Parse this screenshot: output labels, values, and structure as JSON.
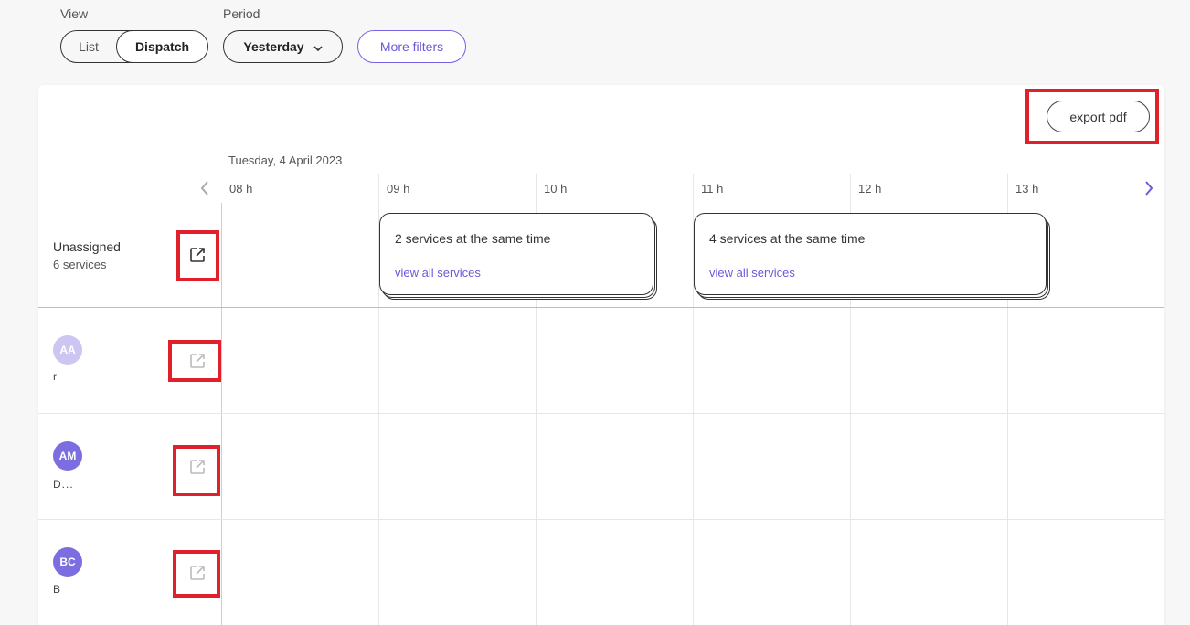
{
  "filters": {
    "view_label": "View",
    "view_options": [
      "List",
      "Dispatch"
    ],
    "view_selected": "Dispatch",
    "period_label": "Period",
    "period_value": "Yesterday",
    "more_filters": "More filters"
  },
  "toolbar": {
    "export_label": "export pdf"
  },
  "timeline": {
    "date": "Tuesday, 4 April 2023",
    "hours": [
      "08 h",
      "09 h",
      "10 h",
      "11 h",
      "12 h",
      "13 h"
    ]
  },
  "unassigned": {
    "title": "Unassigned",
    "count": "6 services",
    "groups": [
      {
        "title": "2 services at the same time",
        "link": "view all services"
      },
      {
        "title": "4 services at the same time",
        "link": "view all services"
      }
    ]
  },
  "resources": [
    {
      "initials": "AA",
      "name": "r",
      "color": "#cdc6f3"
    },
    {
      "initials": "AM",
      "name": "D...",
      "color": "#7c6ee0"
    },
    {
      "initials": "BC",
      "name": "B",
      "color": "#7c6ee0"
    }
  ],
  "icons": {
    "open": "external-link-icon",
    "prev": "chevron-left-icon",
    "next": "chevron-right-icon",
    "dropdown": "chevron-down-icon"
  },
  "colors": {
    "accent": "#6a5ad8",
    "highlight": "#e0202a"
  }
}
